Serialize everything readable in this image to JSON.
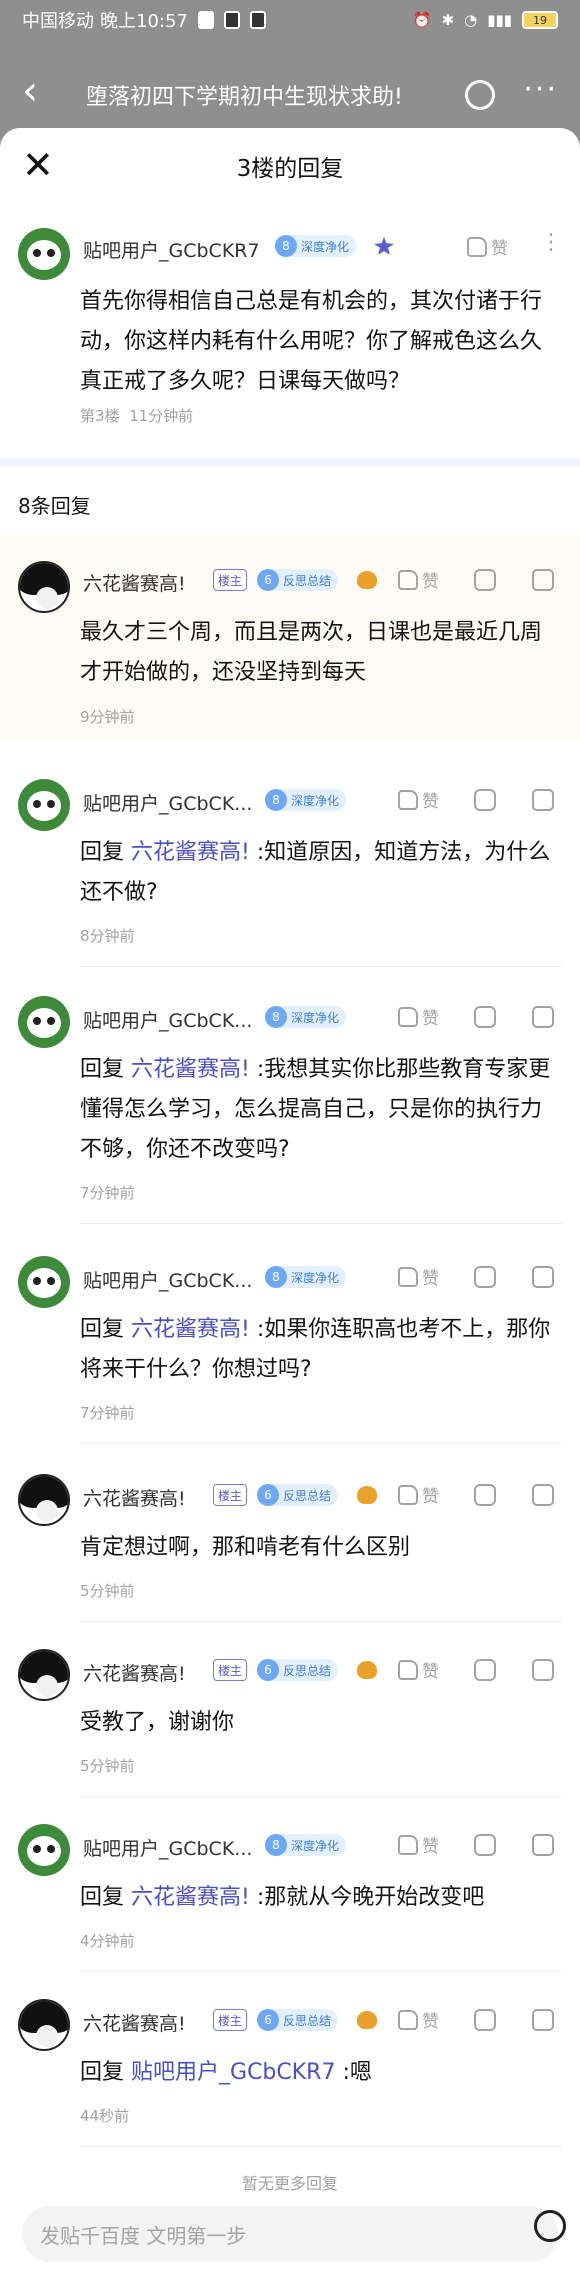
{
  "statusbar": {
    "carrier": "中国移动",
    "time": "晚上10:57",
    "battery": "19"
  },
  "topbar": {
    "title": "堕落初四下学期初中生现状求助!"
  },
  "sheet": {
    "title": "3楼的回复"
  },
  "main_post": {
    "username": "贴吧用户_GCbCKR7",
    "level": "8",
    "level_name": "深度净化",
    "like_label": "赞",
    "content": "首先你得相信自己总是有机会的，其次付诸于行动，你这样内耗有什么用呢？你了解戒色这么久真正戒了多久呢？日课每天做吗？",
    "floor": "第3楼",
    "time": "11分钟前"
  },
  "reply_count": "8条回复",
  "replies": [
    {
      "username": "六花酱赛高!",
      "owner_tag": "楼主",
      "level": "6",
      "level_name": "反思总结",
      "like_label": "赞",
      "content": "最久才三个周，而且是两次，日课也是最近几周才开始做的，还没坚持到每天",
      "time": "9分钟前"
    },
    {
      "username": "贴吧用户_GCbCK...",
      "level": "8",
      "level_name": "深度净化",
      "like_label": "赞",
      "reply_prefix": "回复",
      "reply_to": "六花酱赛高!",
      "content": ":知道原因，知道方法，为什么还不做?",
      "time": "8分钟前"
    },
    {
      "username": "贴吧用户_GCbCK...",
      "level": "8",
      "level_name": "深度净化",
      "like_label": "赞",
      "reply_prefix": "回复",
      "reply_to": "六花酱赛高!",
      "content": ":我想其实你比那些教育专家更懂得怎么学习，怎么提高自己，只是你的执行力不够，你还不改变吗?",
      "time": "7分钟前"
    },
    {
      "username": "贴吧用户_GCbCK...",
      "level": "8",
      "level_name": "深度净化",
      "like_label": "赞",
      "reply_prefix": "回复",
      "reply_to": "六花酱赛高!",
      "content": ":如果你连职高也考不上，那你将来干什么？你想过吗?",
      "time": "7分钟前"
    },
    {
      "username": "六花酱赛高!",
      "owner_tag": "楼主",
      "level": "6",
      "level_name": "反思总结",
      "like_label": "赞",
      "content": "肯定想过啊，那和啃老有什么区别",
      "time": "5分钟前"
    },
    {
      "username": "六花酱赛高!",
      "owner_tag": "楼主",
      "level": "6",
      "level_name": "反思总结",
      "like_label": "赞",
      "content": "受教了，谢谢你",
      "time": "5分钟前"
    },
    {
      "username": "贴吧用户_GCbCK...",
      "level": "8",
      "level_name": "深度净化",
      "like_label": "赞",
      "reply_prefix": "回复",
      "reply_to": "六花酱赛高!",
      "content": ":那就从今晚开始改变吧",
      "time": "4分钟前"
    },
    {
      "username": "六花酱赛高!",
      "owner_tag": "楼主",
      "level": "6",
      "level_name": "反思总结",
      "like_label": "赞",
      "reply_prefix": "回复",
      "reply_to": "贴吧用户_GCbCKR7",
      "content": ":嗯",
      "time": "44秒前"
    }
  ],
  "no_more": "暂无更多回复",
  "input": {
    "placeholder": "发贴千百度 文明第一步"
  },
  "icons": {
    "back": "chevron-left-icon",
    "edit": "edit-icon",
    "more": "more-icon",
    "close": "close-icon",
    "like": "thumb-up-icon",
    "reply": "reply-icon",
    "menu": "more-menu-icon",
    "emoji": "smile-icon"
  },
  "colors": {
    "link": "#4a4fc4",
    "level_bg": "#e3f0ff",
    "level_text": "#3b7de0",
    "highlight": "#fdfbf3"
  }
}
